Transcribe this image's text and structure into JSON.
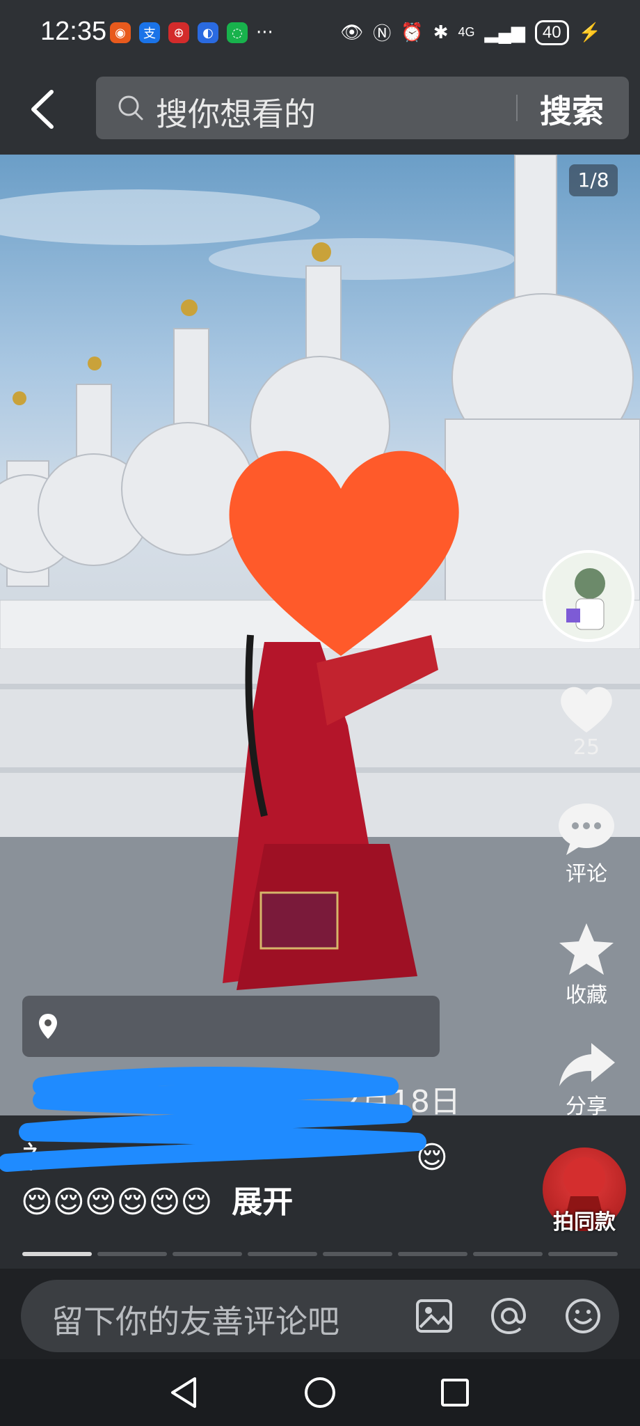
{
  "status_bar": {
    "time": "12:35",
    "network": "4G",
    "battery": "40",
    "app_icons": [
      "news-app-icon",
      "alipay-icon",
      "bank-app-icon",
      "blue-app-icon",
      "wechat-icon"
    ],
    "more_indicator": "···"
  },
  "search": {
    "placeholder": "搜你想看的",
    "button_label": "搜索"
  },
  "photo": {
    "page_counter": "1/8"
  },
  "rail": {
    "like_count": "25",
    "comment_label": "评论",
    "favorite_label": "收藏",
    "share_label": "分享",
    "same_style_label": "拍同款"
  },
  "post": {
    "date_visible": "2月18日",
    "caption_line1_visible": "礻",
    "caption_emoji_line": "😌😌😌😌😌😌",
    "caption_trailing_emoji": "😌",
    "expand_label": "展开"
  },
  "progress": {
    "total_segments": 8,
    "active_index": 0
  },
  "comment_bar": {
    "placeholder": "留下你的友善评论吧"
  },
  "colors": {
    "heart_sticker": "#ff5a2a",
    "scribble_blue": "#1f8bff",
    "dress_red": "#b4152a"
  }
}
